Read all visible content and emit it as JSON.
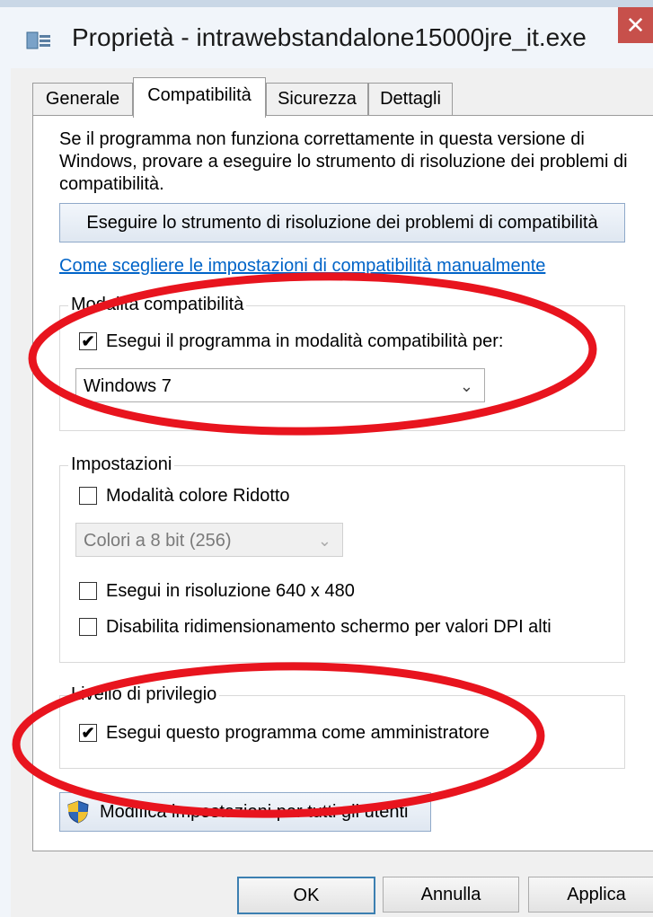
{
  "window": {
    "title": "Proprietà - intrawebstandalone15000jre_it.exe",
    "close_symbol": "✕",
    "app_icon": "properties-window-icon"
  },
  "tabs": [
    {
      "label": "Generale",
      "active": false
    },
    {
      "label": "Compatibilità",
      "active": true
    },
    {
      "label": "Sicurezza",
      "active": false
    },
    {
      "label": "Dettagli",
      "active": false
    }
  ],
  "compat": {
    "description": "Se il programma non funziona correttamente in questa versione di Windows, provare a eseguire lo strumento di risoluzione dei problemi di compatibilità.",
    "troubleshooter_button": "Eseguire lo strumento di risoluzione dei problemi di compatibilità",
    "manual_link": "Come scegliere le impostazioni di compatibilità manualmente"
  },
  "mode_group": {
    "label": "Modalità compatibilità",
    "checkbox_label": "Esegui il programma in modalità compatibilità per:",
    "checked": true,
    "os_selected": "Windows 7"
  },
  "settings_group": {
    "label": "Impostazioni",
    "reduced_color_label": "Modalità colore Ridotto",
    "reduced_color_checked": false,
    "color_select": "Colori a 8 bit (256)",
    "res_label": "Esegui in risoluzione 640 x 480",
    "res_checked": false,
    "dpi_label": "Disabilita ridimensionamento schermo per valori DPI alti",
    "dpi_checked": false
  },
  "privilege_group": {
    "label": "Livello di privilegio",
    "admin_label": "Esegui questo programma come amministratore",
    "admin_checked": true
  },
  "all_users_button": "Modifica impostazioni per tutti gli utenti",
  "footer": {
    "ok": "OK",
    "cancel": "Annulla",
    "apply": "Applica"
  },
  "annotation_color": "#e8141e",
  "check_mark": "✔",
  "chevron": "⌄"
}
